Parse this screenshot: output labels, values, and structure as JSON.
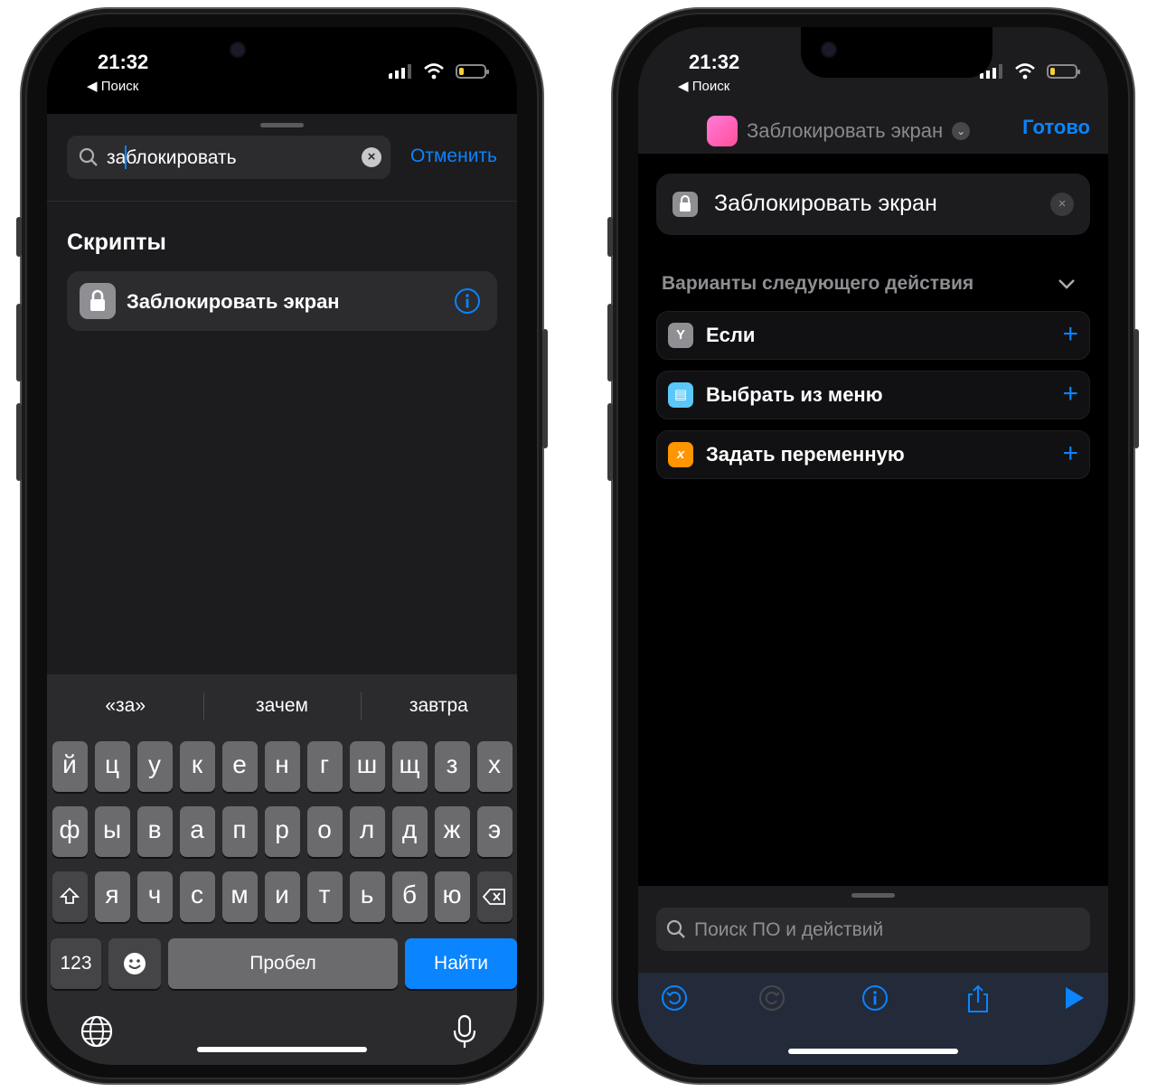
{
  "status": {
    "time": "21:32",
    "back_label": "◀ Поиск"
  },
  "left": {
    "search": {
      "value": "заблокировать",
      "cancel_label": "Отменить"
    },
    "section_title": "Скрипты",
    "result": {
      "label": "Заблокировать экран"
    },
    "suggestions": [
      "«за»",
      "зачем",
      "завтра"
    ],
    "rows": [
      [
        "й",
        "ц",
        "у",
        "к",
        "е",
        "н",
        "г",
        "ш",
        "щ",
        "з",
        "х"
      ],
      [
        "ф",
        "ы",
        "в",
        "а",
        "п",
        "р",
        "о",
        "л",
        "д",
        "ж",
        "э"
      ],
      [
        "я",
        "ч",
        "с",
        "м",
        "и",
        "т",
        "ь",
        "б",
        "ю"
      ]
    ],
    "keys": {
      "numbers": "123",
      "space": "Пробел",
      "go": "Найти"
    }
  },
  "right": {
    "workflow_name": "Заблокировать экран",
    "done_label": "Готово",
    "action": {
      "label": "Заблокировать экран"
    },
    "suggestions_title": "Варианты следующего действия",
    "suggestions": [
      {
        "label": "Если",
        "icon": "if-icon",
        "color": "#8e8e93",
        "glyph": "Y"
      },
      {
        "label": "Выбрать из меню",
        "icon": "menu-icon",
        "color": "#5ac8fa",
        "glyph": "▤"
      },
      {
        "label": "Задать переменную",
        "icon": "variable-icon",
        "color": "#ff9500",
        "glyph": "x"
      }
    ],
    "search_placeholder": "Поиск ПО и действий"
  },
  "colors": {
    "accent": "#0a84ff"
  }
}
